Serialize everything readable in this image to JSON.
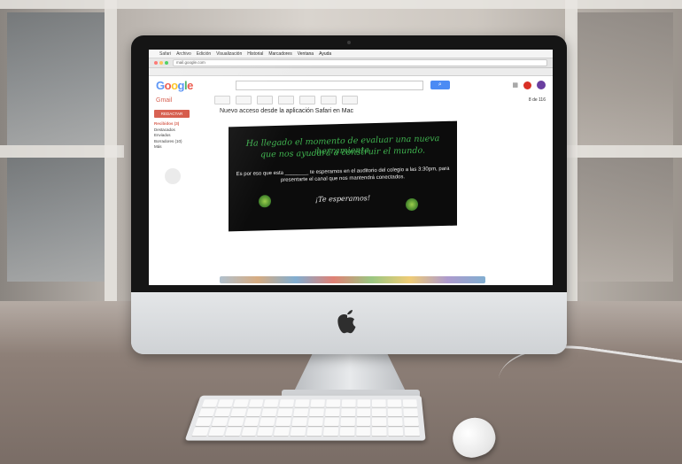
{
  "browser": {
    "menu": [
      "Safari",
      "Archivo",
      "Edición",
      "Visualización",
      "Historial",
      "Marcadores",
      "Ventana",
      "Ayuda"
    ],
    "url": "mail.google.com"
  },
  "gmail": {
    "logo": "Google",
    "app_label": "Gmail",
    "compose_label": "REDACTAR",
    "sidebar_items": [
      "Recibidos (3)",
      "Destacados",
      "Enviados",
      "Borradores (10)",
      "Más"
    ],
    "count": "8 de 116",
    "subject": "Nuevo acceso desde la aplicación Safari en Mac"
  },
  "email_banner": {
    "headline_line1": "Ha llegado el momento de evaluar una nueva herramienta",
    "headline_line2": "que nos ayudará a construir el mundo.",
    "body": "Es por eso que esta ________ te esperamos en el auditorio del colegio a las 3:30pm, para presentarte el canal que nos mantendrá conectados.",
    "invite": "¡Te esperamos!"
  },
  "colors": {
    "banner_bg": "#0c0c0c",
    "banner_green": "#3fb34f",
    "gmail_red": "#d14836",
    "google_blue": "#4b8bf4"
  }
}
